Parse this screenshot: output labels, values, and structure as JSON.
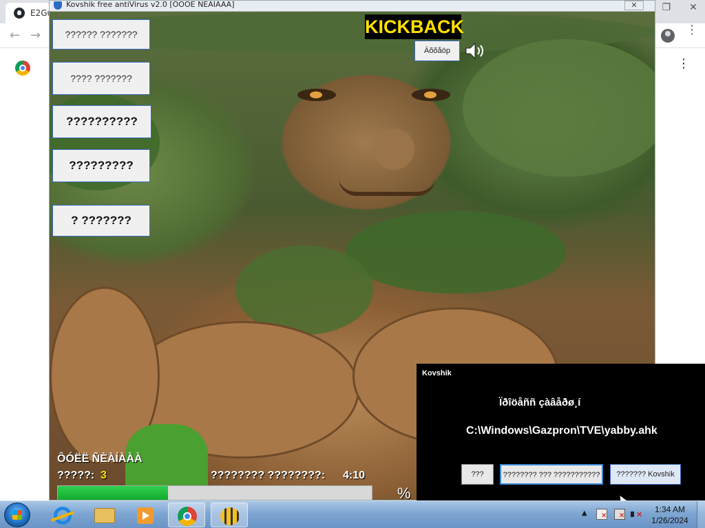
{
  "browser": {
    "tab_label": "E2Gu",
    "window_controls": [
      "minimize-icon",
      "restore-icon",
      "close-icon"
    ],
    "nav_icons": [
      "back-arrow-icon",
      "forward-arrow-icon"
    ],
    "back_glyph": "←",
    "forward_glyph": "→",
    "kebab": "⋮"
  },
  "app": {
    "title": "Kovshik free antiVirus v2.0 [OOOE NEAIAAA]",
    "close_glyph": "✕",
    "menu_buttons": [
      "?????? ???????",
      "???? ???????",
      "??????????",
      "?????????",
      "? ???????"
    ],
    "kickback_label": "KICKBACK",
    "exit_label": "Äõõåöp",
    "stats_title": "ÔÓËË ÑÈÀÍÀÀÀ",
    "level_label": "?????:",
    "level_value": "3",
    "time_label": "???????? ????????:",
    "time_value": "4:10",
    "progress_fraction": 0.35,
    "progress_color": "#1ec13a",
    "percent_label": "%"
  },
  "popup": {
    "title": "Kovshik",
    "message": "Ïðîöåññ çàâåðø¸í",
    "path": "C:\\Windows\\Gazpron\\TVE\\yabby.ahk",
    "buttons": [
      "???",
      "???????? ??? ???????????",
      "??????? Kovshik"
    ]
  },
  "taskbar": {
    "items": [
      "start-orb-icon",
      "internet-explorer-icon",
      "file-explorer-icon",
      "media-player-icon",
      "chrome-icon",
      "bee-app-icon"
    ],
    "tray_arrow": "▲",
    "time": "1:34 AM",
    "date": "1/26/2024"
  },
  "colors": {
    "kickback_text": "#ffe100",
    "level_value": "#ffe100",
    "popup_bg": "#000000",
    "taskbar": "#7ea6d2"
  }
}
